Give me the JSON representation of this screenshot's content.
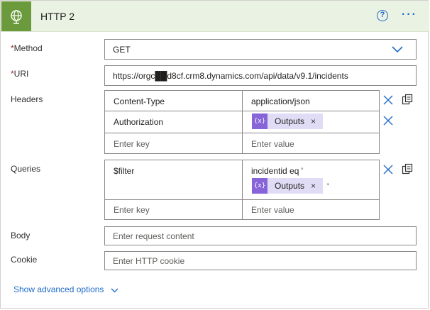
{
  "action": {
    "title": "HTTP 2",
    "help_icon": "?",
    "more_icon": "···"
  },
  "method": {
    "label": "Method",
    "required_marker": "*",
    "value": "GET"
  },
  "uri": {
    "label": "URI",
    "required_marker": "*",
    "value": "https://orgc██d8cf.crm8.dynamics.com/api/data/v9.1/incidents"
  },
  "headers": {
    "label": "Headers",
    "rows": [
      {
        "key": "Content-Type",
        "value": "application/json"
      },
      {
        "key": "Authorization",
        "value_token": "Outputs"
      }
    ],
    "key_placeholder": "Enter key",
    "value_placeholder": "Enter value"
  },
  "queries": {
    "label": "Queries",
    "rows": [
      {
        "key": "$filter",
        "value_text": "incidentid eq '",
        "value_token": "Outputs",
        "value_suffix": "'"
      }
    ],
    "key_placeholder": "Enter key",
    "value_placeholder": "Enter value"
  },
  "body": {
    "label": "Body",
    "placeholder": "Enter request content"
  },
  "cookie": {
    "label": "Cookie",
    "placeholder": "Enter HTTP cookie"
  },
  "advanced_options": "Show advanced options",
  "token_icon_text": "{x}",
  "token_remove": "×",
  "colors": {
    "header_bg": "#eaf2e3",
    "icon_bg": "#6a9a3c",
    "accent": "#1f6bc9",
    "token_bg": "#e1dcf5",
    "token_icon": "#8765d8",
    "required": "#a4262c"
  }
}
